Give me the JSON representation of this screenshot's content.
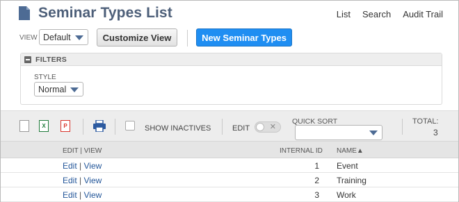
{
  "header": {
    "title": "Seminar Types List",
    "links": [
      "List",
      "Search",
      "Audit Trail"
    ]
  },
  "controls": {
    "view_label": "VIEW",
    "view_value": "Default",
    "customize_label": "Customize View",
    "new_label": "New Seminar Types"
  },
  "filters": {
    "title": "FILTERS",
    "style_label": "STYLE",
    "style_value": "Normal"
  },
  "toolbar": {
    "doc_icon": "document-icon",
    "xls_icon": "excel-icon",
    "pdf_icon": "pdf-icon",
    "print_icon": "print-icon",
    "show_inactives": "SHOW INACTIVES",
    "edit_label": "EDIT",
    "quick_sort_label": "QUICK SORT",
    "quick_sort_value": "",
    "total_label": "TOTAL:",
    "total_value": "3"
  },
  "table": {
    "columns": {
      "edit_view": "EDIT | VIEW",
      "internal_id": "INTERNAL ID",
      "name": "NAME▲"
    },
    "rows": [
      {
        "edit": "Edit",
        "sep": " | ",
        "view": "View",
        "id": "1",
        "name": "Event"
      },
      {
        "edit": "Edit",
        "sep": " | ",
        "view": "View",
        "id": "2",
        "name": "Training"
      },
      {
        "edit": "Edit",
        "sep": " | ",
        "view": "View",
        "id": "3",
        "name": "Work"
      }
    ]
  },
  "colors": {
    "title": "#4d5f79",
    "primary_button": "#1f8ef2",
    "link": "#24579a"
  }
}
